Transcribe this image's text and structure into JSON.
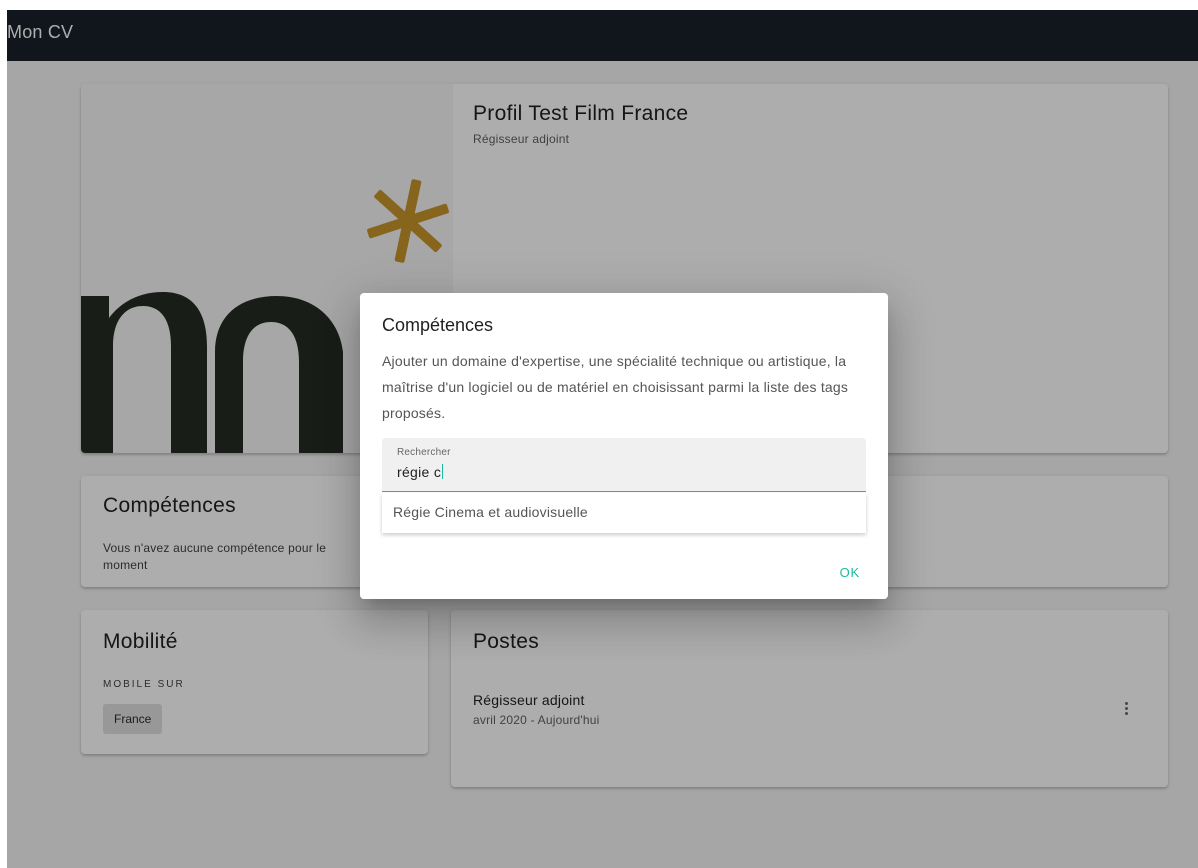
{
  "app": {
    "title": "Mon CV"
  },
  "profile": {
    "name": "Profil Test Film France",
    "role": "Régisseur adjoint",
    "art_colors": {
      "ink": "#262b24",
      "asterisk": "#c8962a"
    }
  },
  "skills_card": {
    "title": "Compétences",
    "empty_message": "Vous n'avez aucune compétence pour le moment"
  },
  "mobility": {
    "title": "Mobilité",
    "caption": "MOBILE SUR",
    "chips": [
      "France"
    ]
  },
  "postes": {
    "title": "Postes",
    "items": [
      {
        "title": "Régisseur adjoint",
        "dates": "avril 2020 - Aujourd'hui",
        "menu_icon": "more-vertical-icon"
      }
    ]
  },
  "dialog": {
    "title": "Compétences",
    "description": "Ajouter un domaine d'expertise, une spécialité technique ou artistique, la maîtrise d'un logiciel ou de matériel en choisissant parmi la liste des tags proposés.",
    "search": {
      "label": "Rechercher",
      "value": "régie c"
    },
    "suggestions": [
      "Régie Cinema et audiovisuelle"
    ],
    "ok_label": "OK"
  },
  "colors": {
    "appbar": "#1a212c",
    "accent": "#1abc9c",
    "scrim": "rgba(0,0,0,0.32)"
  }
}
